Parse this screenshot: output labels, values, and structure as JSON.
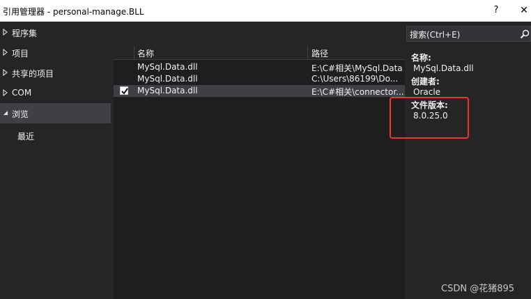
{
  "window": {
    "title": "引用管理器 - personal-manage.BLL",
    "help_label": "?",
    "close_label": "✕"
  },
  "sidebar": {
    "items": [
      {
        "label": "程序集",
        "expanded": false
      },
      {
        "label": "项目",
        "expanded": false
      },
      {
        "label": "共享的项目",
        "expanded": false
      },
      {
        "label": "COM",
        "expanded": false
      },
      {
        "label": "浏览",
        "expanded": true
      }
    ],
    "sub_items": [
      {
        "label": "最近"
      }
    ]
  },
  "list": {
    "columns": {
      "name": "名称",
      "path": "路径"
    },
    "rows": [
      {
        "name": "MySql.Data.dll",
        "path": "E:\\C#相关\\MySql.Data...",
        "checked": false,
        "selected": false
      },
      {
        "name": "MySql.Data.dll",
        "path": "C:\\Users\\86199\\Do...",
        "checked": false,
        "selected": false
      },
      {
        "name": "MySql.Data.dll",
        "path": "E:\\C#相关\\connector...",
        "checked": true,
        "selected": true
      }
    ]
  },
  "search": {
    "placeholder": "搜索(Ctrl+E)",
    "icon": "search-icon"
  },
  "details": {
    "name_label": "名称:",
    "name_value": "MySql.Data.dll",
    "creator_label": "创建者:",
    "creator_value": "Oracle",
    "version_label": "文件版本:",
    "version_value": "8.0.25.0"
  },
  "watermark": "CSDN @花猪895",
  "colors": {
    "background": "#252526",
    "list_background": "#1e1e1e",
    "selection": "#3f3f46",
    "highlight": "#e53935"
  }
}
